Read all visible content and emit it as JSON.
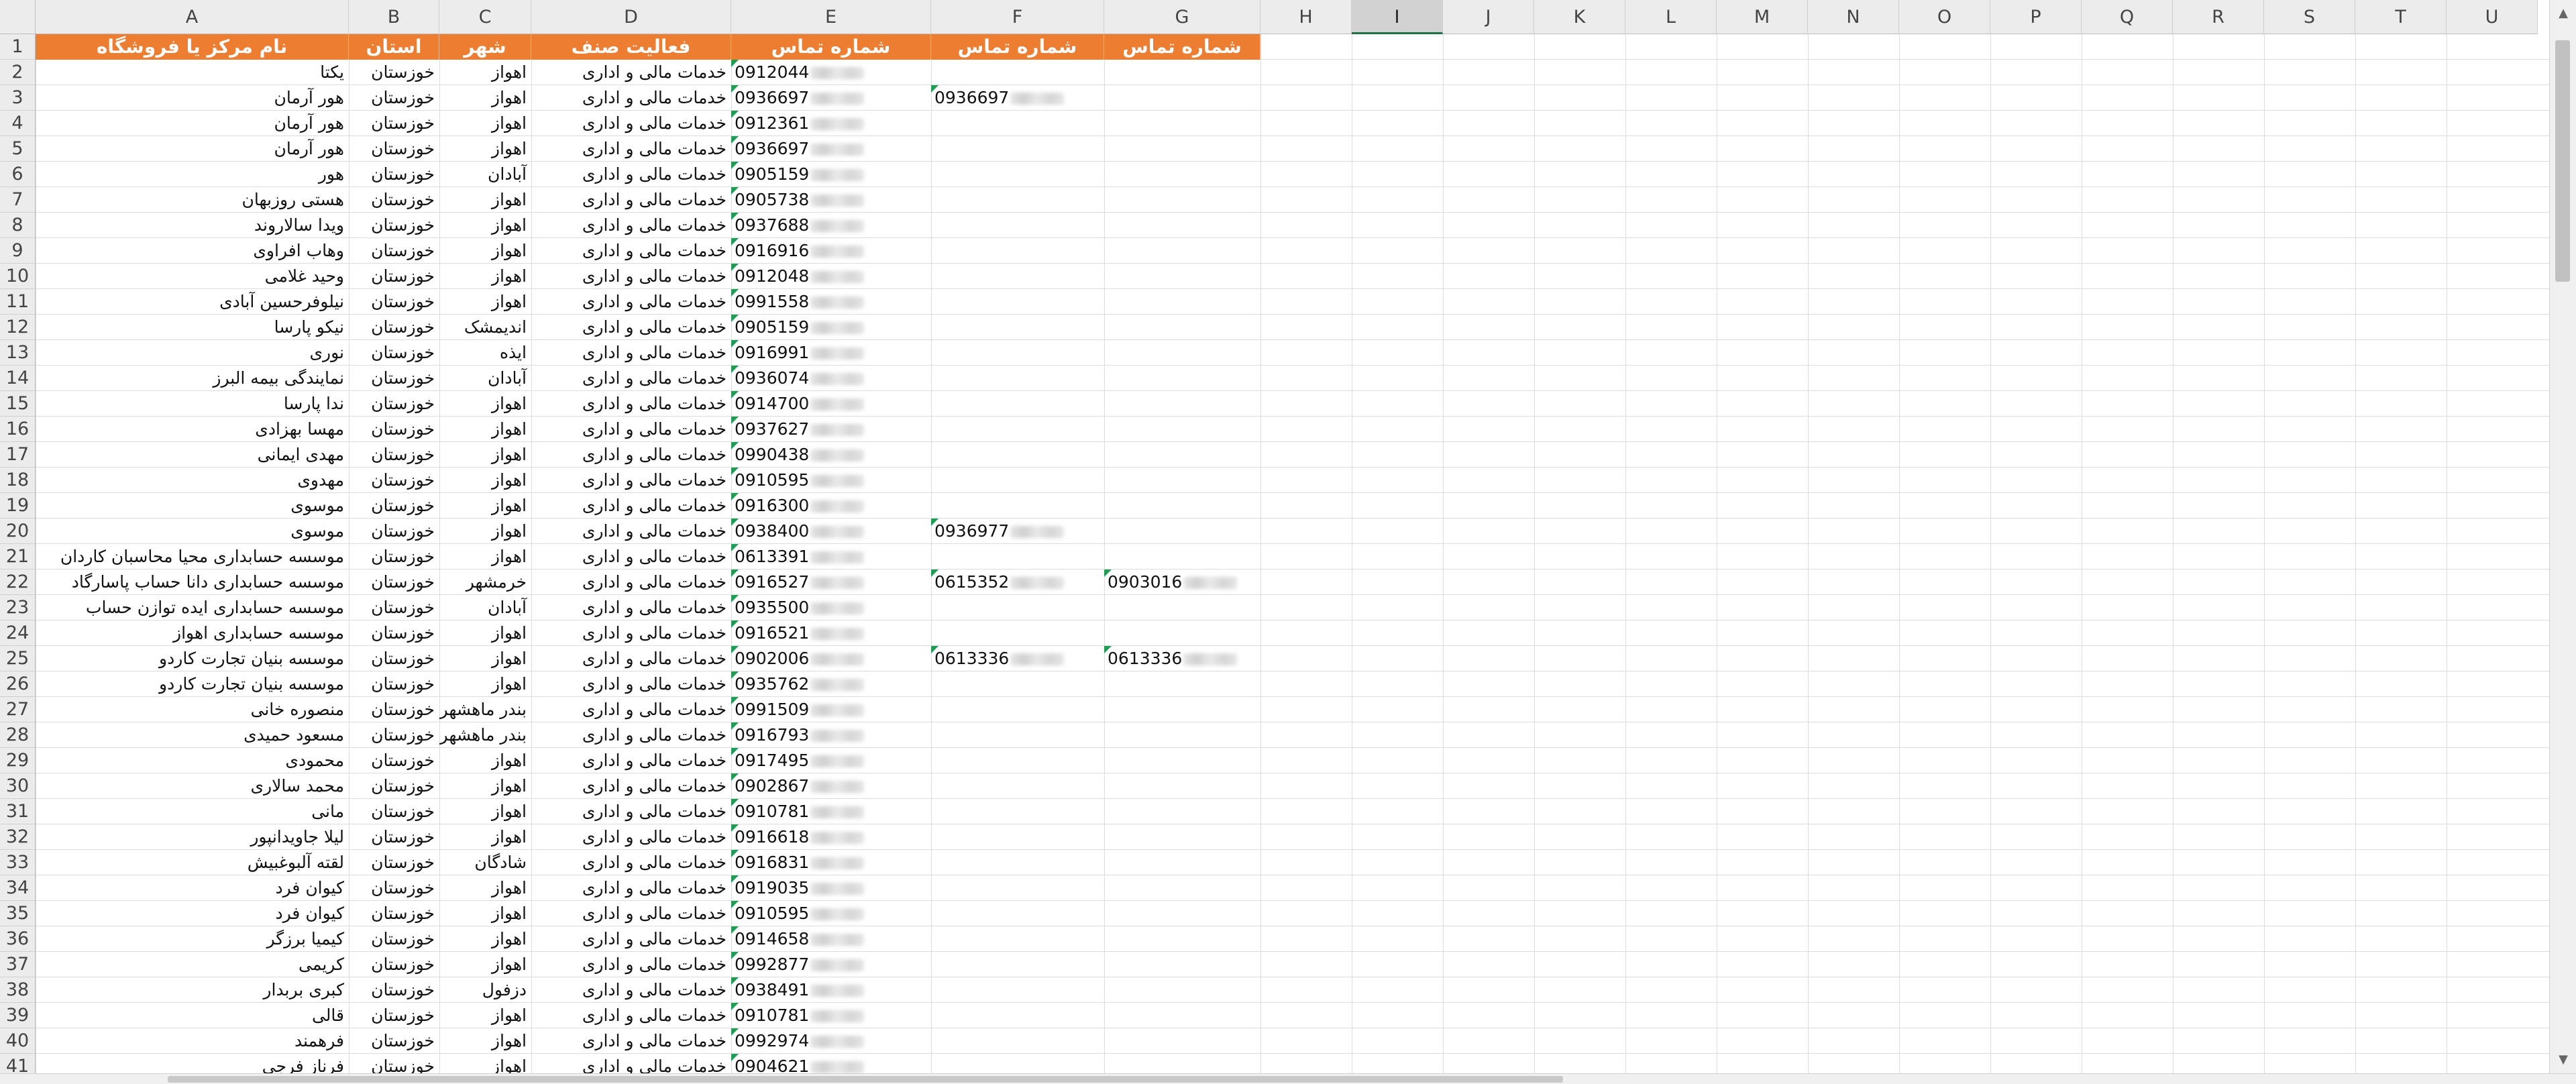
{
  "columns": [
    "A",
    "B",
    "C",
    "D",
    "E",
    "F",
    "G",
    "H",
    "I",
    "J",
    "K",
    "L",
    "M",
    "N",
    "O",
    "P",
    "Q",
    "R",
    "S",
    "T",
    "U"
  ],
  "selected_column": "I",
  "header": {
    "name": "نام مرکز یا فروشگاه",
    "province": "استان",
    "city": "شهر",
    "activity": "فعالیت صنف",
    "phone1": "شماره تماس",
    "phone2": "شماره تماس",
    "phone3": "شماره تماس"
  },
  "accent_colors": {
    "header_fill": "#ed7d31",
    "header_text": "#ffffff",
    "comment_marker": "#1f9d55"
  },
  "rows": [
    {
      "num": "2",
      "name": "یکتا",
      "province": "خوزستان",
      "city": "اهواز",
      "activity": "خدمات مالی و اداری",
      "phone1": "0912044",
      "phone2": "",
      "phone3": ""
    },
    {
      "num": "3",
      "name": "هور آرمان",
      "province": "خوزستان",
      "city": "اهواز",
      "activity": "خدمات مالی و اداری",
      "phone1": "0936697",
      "phone2": "0936697",
      "phone3": ""
    },
    {
      "num": "4",
      "name": "هور آرمان",
      "province": "خوزستان",
      "city": "اهواز",
      "activity": "خدمات مالی و اداری",
      "phone1": "0912361",
      "phone2": "",
      "phone3": ""
    },
    {
      "num": "5",
      "name": "هور آرمان",
      "province": "خوزستان",
      "city": "اهواز",
      "activity": "خدمات مالی و اداری",
      "phone1": "0936697",
      "phone2": "",
      "phone3": ""
    },
    {
      "num": "6",
      "name": "هور",
      "province": "خوزستان",
      "city": "آبادان",
      "activity": "خدمات مالی و اداری",
      "phone1": "0905159",
      "phone2": "",
      "phone3": ""
    },
    {
      "num": "7",
      "name": "هستی روزبهان",
      "province": "خوزستان",
      "city": "اهواز",
      "activity": "خدمات مالی و اداری",
      "phone1": "0905738",
      "phone2": "",
      "phone3": ""
    },
    {
      "num": "8",
      "name": "ویدا سالاروند",
      "province": "خوزستان",
      "city": "اهواز",
      "activity": "خدمات مالی و اداری",
      "phone1": "0937688",
      "phone2": "",
      "phone3": ""
    },
    {
      "num": "9",
      "name": "وهاب افراوی",
      "province": "خوزستان",
      "city": "اهواز",
      "activity": "خدمات مالی و اداری",
      "phone1": "0916916",
      "phone2": "",
      "phone3": ""
    },
    {
      "num": "10",
      "name": "وحید غلامی",
      "province": "خوزستان",
      "city": "اهواز",
      "activity": "خدمات مالی و اداری",
      "phone1": "0912048",
      "phone2": "",
      "phone3": ""
    },
    {
      "num": "11",
      "name": "نیلوفرحسین آبادی",
      "province": "خوزستان",
      "city": "اهواز",
      "activity": "خدمات مالی و اداری",
      "phone1": "0991558",
      "phone2": "",
      "phone3": ""
    },
    {
      "num": "12",
      "name": "نیکو پارسا",
      "province": "خوزستان",
      "city": "اندیمشک",
      "activity": "خدمات مالی و اداری",
      "phone1": "0905159",
      "phone2": "",
      "phone3": ""
    },
    {
      "num": "13",
      "name": "نوری",
      "province": "خوزستان",
      "city": "ایذه",
      "activity": "خدمات مالی و اداری",
      "phone1": "0916991",
      "phone2": "",
      "phone3": ""
    },
    {
      "num": "14",
      "name": "نمایندگی بیمه البرز",
      "province": "خوزستان",
      "city": "آبادان",
      "activity": "خدمات مالی و اداری",
      "phone1": "0936074",
      "phone2": "",
      "phone3": ""
    },
    {
      "num": "15",
      "name": "ندا پارسا",
      "province": "خوزستان",
      "city": "اهواز",
      "activity": "خدمات مالی و اداری",
      "phone1": "0914700",
      "phone2": "",
      "phone3": ""
    },
    {
      "num": "16",
      "name": "مهسا بهزادی",
      "province": "خوزستان",
      "city": "اهواز",
      "activity": "خدمات مالی و اداری",
      "phone1": "0937627",
      "phone2": "",
      "phone3": ""
    },
    {
      "num": "17",
      "name": "مهدی ایمانی",
      "province": "خوزستان",
      "city": "اهواز",
      "activity": "خدمات مالی و اداری",
      "phone1": "0990438",
      "phone2": "",
      "phone3": ""
    },
    {
      "num": "18",
      "name": "مهدوی",
      "province": "خوزستان",
      "city": "اهواز",
      "activity": "خدمات مالی و اداری",
      "phone1": "0910595",
      "phone2": "",
      "phone3": ""
    },
    {
      "num": "19",
      "name": "موسوی",
      "province": "خوزستان",
      "city": "اهواز",
      "activity": "خدمات مالی و اداری",
      "phone1": "0916300",
      "phone2": "",
      "phone3": ""
    },
    {
      "num": "20",
      "name": "موسوی",
      "province": "خوزستان",
      "city": "اهواز",
      "activity": "خدمات مالی و اداری",
      "phone1": "0938400",
      "phone2": "0936977",
      "phone3": ""
    },
    {
      "num": "21",
      "name": "موسسه حسابداری محیا محاسبان کاردان",
      "province": "خوزستان",
      "city": "اهواز",
      "activity": "خدمات مالی و اداری",
      "phone1": "0613391",
      "phone2": "",
      "phone3": ""
    },
    {
      "num": "22",
      "name": "موسسه حسابداری دانا حساب پاسارگاد",
      "province": "خوزستان",
      "city": "خرمشهر",
      "activity": "خدمات مالی و اداری",
      "phone1": "0916527",
      "phone2": "0615352",
      "phone3": "0903016"
    },
    {
      "num": "23",
      "name": "موسسه حسابداری ایده توازن حساب",
      "province": "خوزستان",
      "city": "آبادان",
      "activity": "خدمات مالی و اداری",
      "phone1": "0935500",
      "phone2": "",
      "phone3": ""
    },
    {
      "num": "24",
      "name": "موسسه حسابداری اهواز",
      "province": "خوزستان",
      "city": "اهواز",
      "activity": "خدمات مالی و اداری",
      "phone1": "0916521",
      "phone2": "",
      "phone3": ""
    },
    {
      "num": "25",
      "name": "موسسه بنیان تجارت کاردو",
      "province": "خوزستان",
      "city": "اهواز",
      "activity": "خدمات مالی و اداری",
      "phone1": "0902006",
      "phone2": "0613336",
      "phone3": "0613336"
    },
    {
      "num": "26",
      "name": "موسسه بنیان تجارت کاردو",
      "province": "خوزستان",
      "city": "اهواز",
      "activity": "خدمات مالی و اداری",
      "phone1": "0935762",
      "phone2": "",
      "phone3": ""
    },
    {
      "num": "27",
      "name": "منصوره خانی",
      "province": "خوزستان",
      "city": "بندر ماهشهر",
      "activity": "خدمات مالی و اداری",
      "phone1": "0991509",
      "phone2": "",
      "phone3": ""
    },
    {
      "num": "28",
      "name": "مسعود حمیدی",
      "province": "خوزستان",
      "city": "بندر ماهشهر",
      "activity": "خدمات مالی و اداری",
      "phone1": "0916793",
      "phone2": "",
      "phone3": ""
    },
    {
      "num": "29",
      "name": "محمودی",
      "province": "خوزستان",
      "city": "اهواز",
      "activity": "خدمات مالی و اداری",
      "phone1": "0917495",
      "phone2": "",
      "phone3": ""
    },
    {
      "num": "30",
      "name": "محمد سالاری",
      "province": "خوزستان",
      "city": "اهواز",
      "activity": "خدمات مالی و اداری",
      "phone1": "0902867",
      "phone2": "",
      "phone3": ""
    },
    {
      "num": "31",
      "name": "مانی",
      "province": "خوزستان",
      "city": "اهواز",
      "activity": "خدمات مالی و اداری",
      "phone1": "0910781",
      "phone2": "",
      "phone3": ""
    },
    {
      "num": "32",
      "name": "لیلا جاویدانپور",
      "province": "خوزستان",
      "city": "اهواز",
      "activity": "خدمات مالی و اداری",
      "phone1": "0916618",
      "phone2": "",
      "phone3": ""
    },
    {
      "num": "33",
      "name": "لقته آلبوغبیش",
      "province": "خوزستان",
      "city": "شادگان",
      "activity": "خدمات مالی و اداری",
      "phone1": "0916831",
      "phone2": "",
      "phone3": ""
    },
    {
      "num": "34",
      "name": "کیوان فرد",
      "province": "خوزستان",
      "city": "اهواز",
      "activity": "خدمات مالی و اداری",
      "phone1": "0919035",
      "phone2": "",
      "phone3": ""
    },
    {
      "num": "35",
      "name": "کیوان فرد",
      "province": "خوزستان",
      "city": "اهواز",
      "activity": "خدمات مالی و اداری",
      "phone1": "0910595",
      "phone2": "",
      "phone3": ""
    },
    {
      "num": "36",
      "name": "کیمیا برزگر",
      "province": "خوزستان",
      "city": "اهواز",
      "activity": "خدمات مالی و اداری",
      "phone1": "0914658",
      "phone2": "",
      "phone3": ""
    },
    {
      "num": "37",
      "name": "کریمی",
      "province": "خوزستان",
      "city": "اهواز",
      "activity": "خدمات مالی و اداری",
      "phone1": "0992877",
      "phone2": "",
      "phone3": ""
    },
    {
      "num": "38",
      "name": "کبری بربدار",
      "province": "خوزستان",
      "city": "دزفول",
      "activity": "خدمات مالی و اداری",
      "phone1": "0938491",
      "phone2": "",
      "phone3": ""
    },
    {
      "num": "39",
      "name": "قالی",
      "province": "خوزستان",
      "city": "اهواز",
      "activity": "خدمات مالی و اداری",
      "phone1": "0910781",
      "phone2": "",
      "phone3": ""
    },
    {
      "num": "40",
      "name": "فرهمند",
      "province": "خوزستان",
      "city": "اهواز",
      "activity": "خدمات مالی و اداری",
      "phone1": "0992974",
      "phone2": "",
      "phone3": ""
    },
    {
      "num": "41",
      "name": "فرناز فرجی",
      "province": "خوزستان",
      "city": "اهواز",
      "activity": "خدمات مالی و اداری",
      "phone1": "0904621",
      "phone2": "",
      "phone3": ""
    }
  ]
}
